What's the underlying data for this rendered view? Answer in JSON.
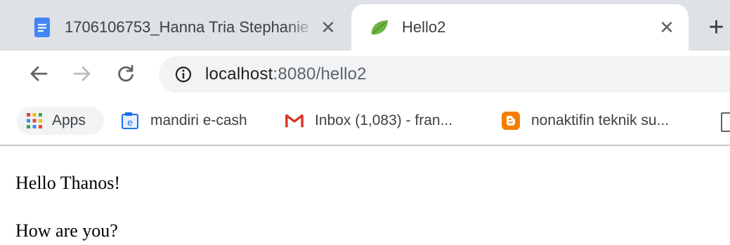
{
  "tabs": [
    {
      "title": "1706106753_Hanna Tria Stephanie",
      "favicon": "google-docs-icon",
      "active": false
    },
    {
      "title": "Hello2",
      "favicon": "spring-leaf-icon",
      "active": true
    }
  ],
  "toolbar": {
    "url_host": "localhost",
    "url_rest": ":8080/hello2"
  },
  "bookmarks": [
    {
      "label": "Apps",
      "icon": "apps-grid-icon"
    },
    {
      "label": "mandiri e-cash",
      "icon": "ecash-icon"
    },
    {
      "label": "Inbox (1,083) - fran...",
      "icon": "gmail-icon"
    },
    {
      "label": "nonaktifin teknik su...",
      "icon": "blogger-icon"
    }
  ],
  "page": {
    "line1": "Hello Thanos!",
    "line2": "How are you?"
  },
  "colors": {
    "tabstrip_bg": "#dee1e6",
    "omnibox_bg": "#f1f3f4",
    "docs_blue": "#4285f4",
    "spring_green": "#6db33f",
    "gmail_red": "#d93025",
    "blogger_orange": "#f57d00"
  }
}
